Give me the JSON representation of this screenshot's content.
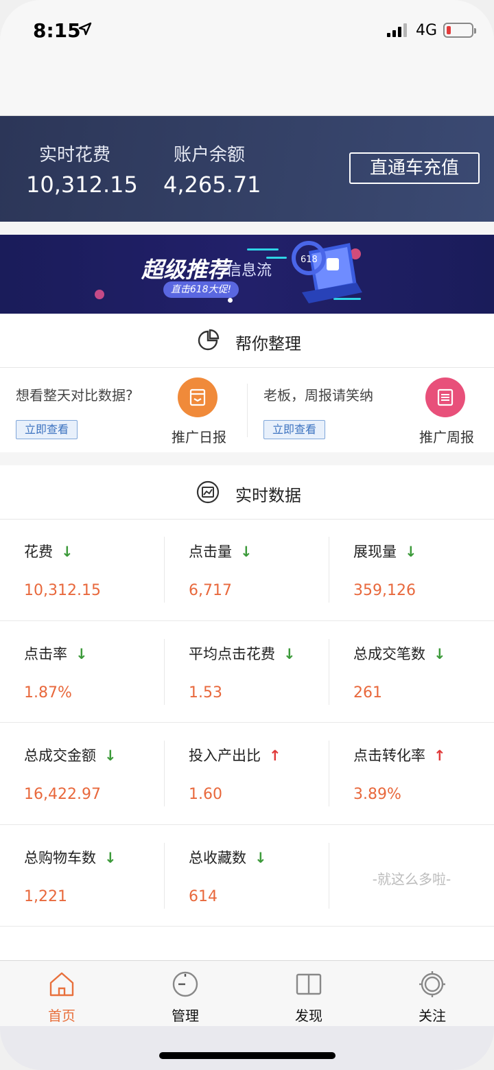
{
  "status_bar": {
    "time": "8:15",
    "network": "4G"
  },
  "account": {
    "spend_label": "实时花费",
    "spend_value": "10,312.15",
    "balance_label": "账户余额",
    "balance_value": "4,265.71",
    "recharge_button": "直通车充值"
  },
  "banner": {
    "title": "超级推荐",
    "subtitle": "信息流",
    "pill": "直击618大促!",
    "badge": "618"
  },
  "organize": {
    "title": "帮你整理",
    "left": {
      "tip": "想看整天对比数据?",
      "button": "立即查看",
      "label": "推广日报",
      "color": "#f08a3a"
    },
    "right": {
      "tip": "老板，周报请笑纳",
      "button": "立即查看",
      "label": "推广周报",
      "color": "#e8507a"
    }
  },
  "realtime": {
    "title": "实时数据",
    "metrics": [
      {
        "label": "花费",
        "value": "10,312.15",
        "trend": "down",
        "arrow": "↓"
      },
      {
        "label": "点击量",
        "value": "6,717",
        "trend": "down",
        "arrow": "↓"
      },
      {
        "label": "展现量",
        "value": "359,126",
        "trend": "down",
        "arrow": "↓"
      },
      {
        "label": "点击率",
        "value": "1.87%",
        "trend": "down",
        "arrow": "↓"
      },
      {
        "label": "平均点击花费",
        "value": "1.53",
        "trend": "down",
        "arrow": "↓"
      },
      {
        "label": "总成交笔数",
        "value": "261",
        "trend": "down",
        "arrow": "↓"
      },
      {
        "label": "总成交金额",
        "value": "16,422.97",
        "trend": "down",
        "arrow": "↓"
      },
      {
        "label": "投入产出比",
        "value": "1.60",
        "trend": "up",
        "arrow": "↑"
      },
      {
        "label": "点击转化率",
        "value": "3.89%",
        "trend": "up",
        "arrow": "↑"
      },
      {
        "label": "总购物车数",
        "value": "1,221",
        "trend": "down",
        "arrow": "↓"
      },
      {
        "label": "总收藏数",
        "value": "614",
        "trend": "down",
        "arrow": "↓"
      }
    ],
    "end_note": "-就这么多啦-"
  },
  "tabs": [
    {
      "label": "首页",
      "icon": "home-icon",
      "active": true
    },
    {
      "label": "管理",
      "icon": "gauge-icon",
      "active": false
    },
    {
      "label": "发现",
      "icon": "book-icon",
      "active": false
    },
    {
      "label": "关注",
      "icon": "target-icon",
      "active": false
    }
  ],
  "colors": {
    "accent": "#e8703c",
    "header_bg": "#2f3a5f",
    "down": "#3c9a3a",
    "up": "#e03a3a"
  }
}
